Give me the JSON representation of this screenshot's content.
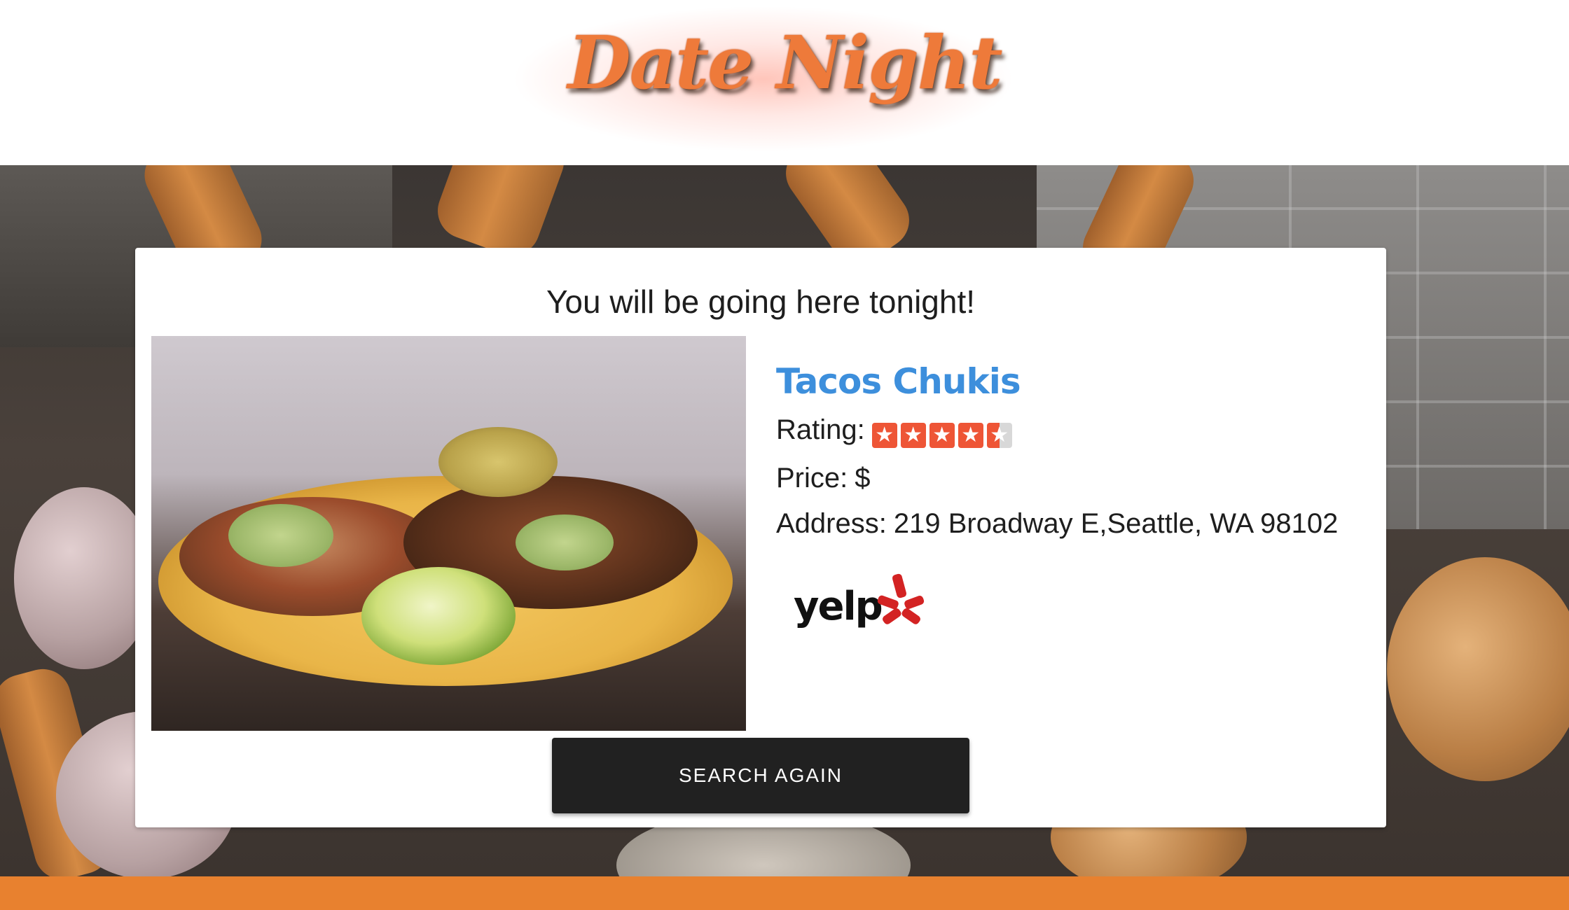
{
  "header": {
    "logo_text": "Date Night"
  },
  "card": {
    "title": "You will be going here tonight!",
    "restaurant": {
      "name": "Tacos Chukis",
      "rating_label": "Rating:",
      "rating": 4.5,
      "rating_max": 5,
      "price_label": "Price:",
      "price": "$",
      "address_label": "Address:",
      "address": "219 Broadway E,Seattle, WA 98102"
    },
    "yelp_logo_text": "yelp",
    "search_again_label": "SEARCH AGAIN"
  },
  "colors": {
    "accent_orange": "#e8812f",
    "logo_orange": "#ee7a3a",
    "link_blue": "#3d8fdc",
    "star_red": "#ee5536",
    "button_dark": "#212121",
    "yelp_red": "#d32323"
  },
  "icons": {
    "star": "star-icon",
    "yelp_burst": "yelp-burst-icon"
  }
}
